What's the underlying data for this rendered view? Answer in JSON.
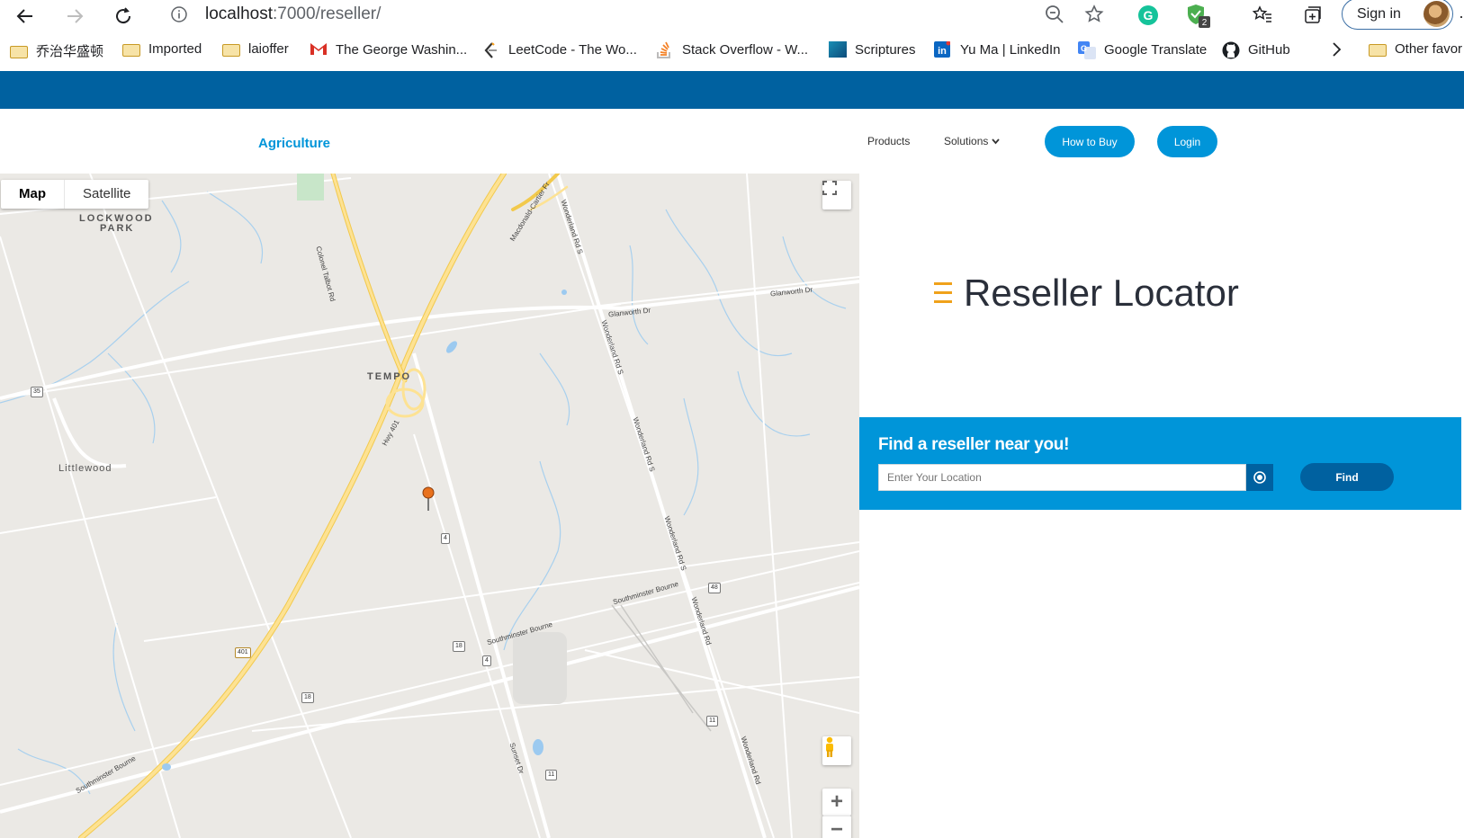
{
  "browser": {
    "url_host": "localhost",
    "url_path": ":7000/reseller/",
    "ext_badge": "2",
    "signin_label": "Sign in",
    "more_label": "·"
  },
  "bookmarks": [
    {
      "label": "乔治华盛顿",
      "icon": "folder-icon"
    },
    {
      "label": "Imported",
      "icon": "folder-icon"
    },
    {
      "label": "laioffer",
      "icon": "folder-icon"
    },
    {
      "label": "The George Washin...",
      "icon": "gmail-icon"
    },
    {
      "label": "LeetCode - The Wo...",
      "icon": "leetcode-icon"
    },
    {
      "label": "Stack Overflow - W...",
      "icon": "stackoverflow-icon"
    },
    {
      "label": "Scriptures",
      "icon": "scriptures-icon"
    },
    {
      "label": "Yu Ma | LinkedIn",
      "icon": "linkedin-icon"
    },
    {
      "label": "Google Translate",
      "icon": "translate-icon"
    },
    {
      "label": "GitHub",
      "icon": "github-icon"
    },
    {
      "label": "Other favor",
      "icon": "folder-icon"
    }
  ],
  "header": {
    "brand": "Agriculture",
    "nav": {
      "products": "Products",
      "solutions": "Solutions"
    },
    "how_to_buy": "How to Buy",
    "login": "Login"
  },
  "map": {
    "type_map": "Map",
    "type_satellite": "Satellite",
    "places": {
      "lockwood1": "LOCKWOOD",
      "lockwood2": "PARK",
      "tempo": "TEMPO",
      "littlewood": "Littlewood"
    },
    "roads": {
      "colonel": "Colonel Talbot Rd",
      "macdonald": "Macdonald-Cartier Fr",
      "wonderland1": "Wonderland Rd S",
      "wonderland2": "Wonderland Rd S",
      "wonderland3": "Wonderland Rd S",
      "wonderland4": "Wonderland Rd S",
      "wonderland5": "Wonderland Rd",
      "wonderland6": "Wonderland Rd",
      "glanworth1": "Glanworth Dr",
      "glanworth2": "Glanworth Dr",
      "hwy401": "Hwy 401",
      "south1": "Southminster Bourne",
      "south2": "Southminster Bourne",
      "south3": "Southminster Bourne",
      "sunset": "Sunset Dr"
    },
    "shields": {
      "s35": "35",
      "s4a": "4",
      "s4b": "4",
      "s18a": "18",
      "s18b": "18",
      "s401": "401",
      "s48": "48",
      "s11a": "11",
      "s11b": "11"
    },
    "zoom_in": "+",
    "zoom_out": "−"
  },
  "locator": {
    "title": "Reseller Locator",
    "find_title": "Find a reseller near you!",
    "input_placeholder": "Enter Your Location",
    "find_label": "Find"
  },
  "colors": {
    "brand_blue": "#0095d9",
    "dark_blue": "#0061a0",
    "accent_orange": "#f0a21b"
  }
}
